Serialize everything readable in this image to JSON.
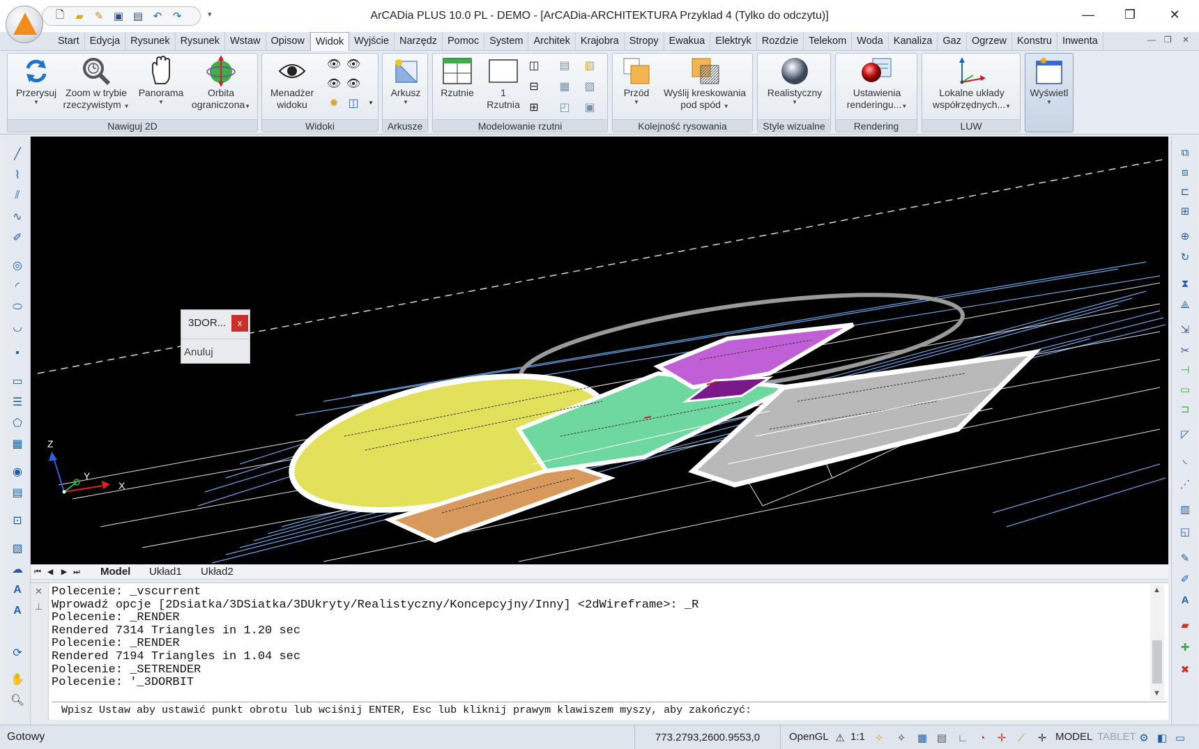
{
  "window": {
    "title": "ArCADia PLUS 10.0 PL - DEMO  - [ArCADia-ARCHITEKTURA Przyklad 4 (Tylko do odczytu)]",
    "minimize_glyph": "—",
    "restore_glyph": "❐",
    "close_glyph": "✕"
  },
  "quick_access": [
    "new-icon",
    "open-icon",
    "cad-icon",
    "save-icon",
    "save-as-icon",
    "undo-icon",
    "redo-icon"
  ],
  "ribbon_tabs": [
    {
      "label": "Start"
    },
    {
      "label": "Edycja"
    },
    {
      "label": "Rysunek"
    },
    {
      "label": "Rysunek"
    },
    {
      "label": "Wstaw"
    },
    {
      "label": "Opisow"
    },
    {
      "label": "Widok",
      "active": true
    },
    {
      "label": "Wyjście"
    },
    {
      "label": "Narzędz"
    },
    {
      "label": "Pomoc"
    },
    {
      "label": "System"
    },
    {
      "label": "Architek"
    },
    {
      "label": "Krajobra"
    },
    {
      "label": "Stropy"
    },
    {
      "label": "Ewakua"
    },
    {
      "label": "Elektryk"
    },
    {
      "label": "Rozdzie"
    },
    {
      "label": "Telekom"
    },
    {
      "label": "Woda"
    },
    {
      "label": "Kanaliza"
    },
    {
      "label": "Gaz"
    },
    {
      "label": "Ogrzew"
    },
    {
      "label": "Konstru"
    },
    {
      "label": "Inwenta"
    }
  ],
  "ribbon": {
    "nawiguj": {
      "title": "Nawiguj 2D",
      "przerysuj": "Przerysuj",
      "zoom_line1": "Zoom w trybie",
      "zoom_line2": "rzeczywistym",
      "panorama": "Panorama",
      "orbita_line1": "Orbita",
      "orbita_line2": "ograniczona"
    },
    "widoki": {
      "title": "Widoki",
      "menadzer_line1": "Menadżer",
      "menadzer_line2": "widoku"
    },
    "arkusze": {
      "title": "Arkusze",
      "arkusz": "Arkusz"
    },
    "modelowanie": {
      "title": "Modelowanie rzutni",
      "rzutnie": "Rzutnie",
      "rzutnia_line1": "1",
      "rzutnia_line2": "Rzutnia"
    },
    "kolejnosc": {
      "title": "Kolejność rysowania",
      "przod": "Przód",
      "wyslij_line1": "Wyślij kreskowania",
      "wyslij_line2": "pod spód"
    },
    "style": {
      "title": "Style wizualne",
      "realistyczny": "Realistyczny"
    },
    "rendering": {
      "title": "Rendering",
      "ustawienia_line1": "Ustawienia",
      "ustawienia_line2": "renderingu..."
    },
    "luw": {
      "title": "LUW",
      "lokalne_line1": "Lokalne układy",
      "lokalne_line2": "współrzędnych..."
    },
    "wyswietl": {
      "label": "Wyświetl"
    }
  },
  "float_dialog": {
    "title": "3DOR...",
    "close": "x",
    "cancel": "Anuluj"
  },
  "axes": {
    "x": "X",
    "y": "Y",
    "z": "Z"
  },
  "layout_tabs": [
    {
      "label": "Model",
      "active": true
    },
    {
      "label": "Układ1"
    },
    {
      "label": "Układ2"
    }
  ],
  "command_history": [
    "Polecenie: _vscurrent",
    "Wprowadź opcje [2Dsiatka/3DSiatka/3DUkryty/Realistyczny/Koncepcyjny/Inny] <2dWireframe>: _R",
    "Polecenie: _RENDER",
    "Rendered 7314 Triangles in 1.20 sec",
    "Polecenie: _RENDER",
    "Rendered 7194 Triangles in 1.04 sec",
    "Polecenie: _SETRENDER",
    "Polecenie: '_3DORBIT"
  ],
  "command_prompt": "Wpisz Ustaw aby ustawić punkt obrotu lub wciśnij ENTER, Esc lub kliknij prawym klawiszem myszy, aby zakończyć:",
  "status": {
    "ready": "Gotowy",
    "coords": "773.2793,2600.9553,0",
    "opengl": "OpenGL",
    "scale": "1:1",
    "model": "MODEL",
    "tablet": "TABLET"
  },
  "colors": {
    "yellow_zone": "#e3e05c",
    "green_zone": "#6fd8a0",
    "magenta_zone": "#c15fd6",
    "purple_zone": "#7a1a8a",
    "orange_zone": "#d89a5c",
    "gray_zone": "#b9b9b9",
    "blueprint_lines": "#6aa6e8",
    "accent_orange": "#f28c1e"
  }
}
